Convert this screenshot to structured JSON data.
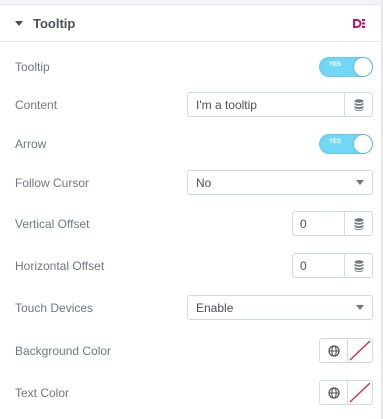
{
  "section": {
    "title": "Tooltip"
  },
  "fields": {
    "tooltip": {
      "label": "Tooltip",
      "toggle": "YES"
    },
    "content": {
      "label": "Content",
      "value": "I'm a tooltip"
    },
    "arrow": {
      "label": "Arrow",
      "toggle": "YES"
    },
    "follow_cursor": {
      "label": "Follow Cursor",
      "value": "No"
    },
    "vertical_offset": {
      "label": "Vertical Offset",
      "value": "0"
    },
    "horizontal_offset": {
      "label": "Horizontal Offset",
      "value": "0"
    },
    "touch_devices": {
      "label": "Touch Devices",
      "value": "Enable"
    },
    "background_color": {
      "label": "Background Color"
    },
    "text_color": {
      "label": "Text Color"
    }
  },
  "colors": {
    "toggle_on": "#71d7f7",
    "brand": "#d30c5c",
    "swatch_empty_line": "#e0233a"
  },
  "icons": {
    "caret": "caret-down-icon",
    "brand": "dynamic-elements-logo",
    "database": "database-icon",
    "globe": "globe-icon",
    "dropdown": "chevron-down-icon"
  }
}
